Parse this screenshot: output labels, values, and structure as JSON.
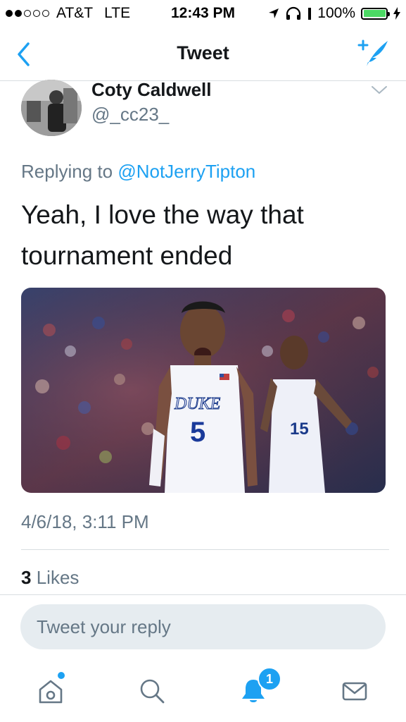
{
  "status_bar": {
    "carrier": "AT&T",
    "network": "LTE",
    "time": "12:43 PM",
    "battery": "100%",
    "signal_bars_filled": 2,
    "signal_bars_total": 5
  },
  "nav": {
    "title": "Tweet",
    "back_icon": "chevron-left-icon",
    "compose_icon": "compose-tweet-icon",
    "accent_color": "#1da1f2"
  },
  "tweet": {
    "author_name": "Coty Caldwell",
    "author_handle": "@_cc23_",
    "replying_prefix": "Replying to",
    "replying_to": "@NotJerryTipton",
    "text": "Yeah, I love the way that tournament ended",
    "timestamp": "4/6/18, 3:11 PM",
    "likes_count": "3",
    "likes_label": "Likes",
    "media_description_icon": "photo",
    "jersey_front": "DUKE",
    "jersey_number_front": "5",
    "jersey_number_back": "15"
  },
  "reply": {
    "placeholder": "Tweet your reply"
  },
  "tab_bar": {
    "items": [
      "home-icon",
      "search-icon",
      "notifications-icon",
      "messages-icon"
    ],
    "notifications_badge": "1"
  }
}
